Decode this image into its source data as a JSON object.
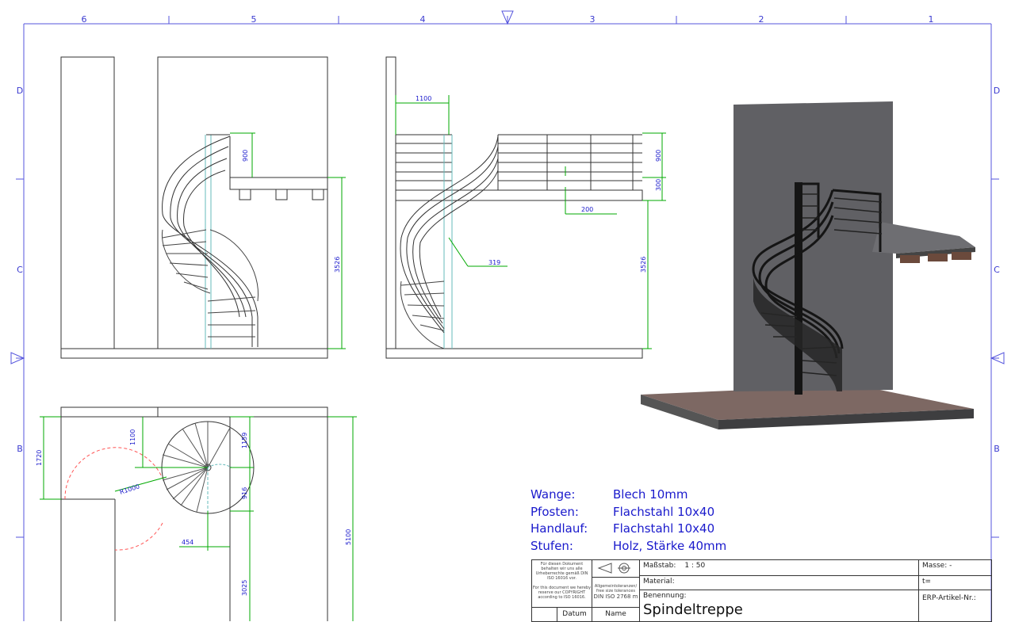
{
  "frame": {
    "columns": [
      "6",
      "5",
      "4",
      "3",
      "2",
      "1"
    ],
    "rows": [
      "D",
      "C",
      "B"
    ]
  },
  "dimensions": {
    "side_rail_height": "900",
    "side_total_height": "3526",
    "front_top_width": "1100",
    "front_rail_height": "900",
    "front_beam_height": "300",
    "front_offset": "200",
    "front_width_319": "319",
    "front_total_height": "3526",
    "plan_1720": "1720",
    "plan_1100": "1100",
    "plan_radius": "R1000",
    "plan_1159": "1159",
    "plan_916": "916",
    "plan_454": "454",
    "plan_5100": "5100",
    "plan_3025": "3025"
  },
  "notes": [
    {
      "key": "Wange:",
      "value": " Blech 10mm"
    },
    {
      "key": "Pfosten:",
      "value": "Flachstahl 10x40"
    },
    {
      "key": "Handlauf:",
      "value": "Flachstahl 10x40"
    },
    {
      "key": "Stufen:",
      "value": "Holz, Stärke 40mm"
    }
  ],
  "title_block": {
    "copyright_de": "Für diesen Dokument behalten wir uns alle Urheberrechte gemäß DIN ISO 16016 vor.",
    "copyright_en": "For this document we hereby reserve our COPYRIGHT according to ISO 16016.",
    "tolerance_note": "Allgemeintoleranzen/ free size tolerances",
    "tolerance_std": "DIN ISO 2768 m",
    "scale_label": "Maßstab:",
    "scale_value": "1 : 50",
    "material_label": "Material:",
    "name_label": "Benennung:",
    "name_value": "Spindeltreppe",
    "mass_label": "Masse: -",
    "t_label": "t=",
    "erp_label": "ERP-Artikel-Nr.:",
    "date_label": "Datum",
    "person_label": "Name"
  },
  "colors": {
    "frame": "#3a3ad0",
    "dimension": "#00aa00",
    "dim_text": "#1a1acc",
    "reference": "#ff4444",
    "wall": "#5e5e62",
    "floor": "#7a6560"
  }
}
